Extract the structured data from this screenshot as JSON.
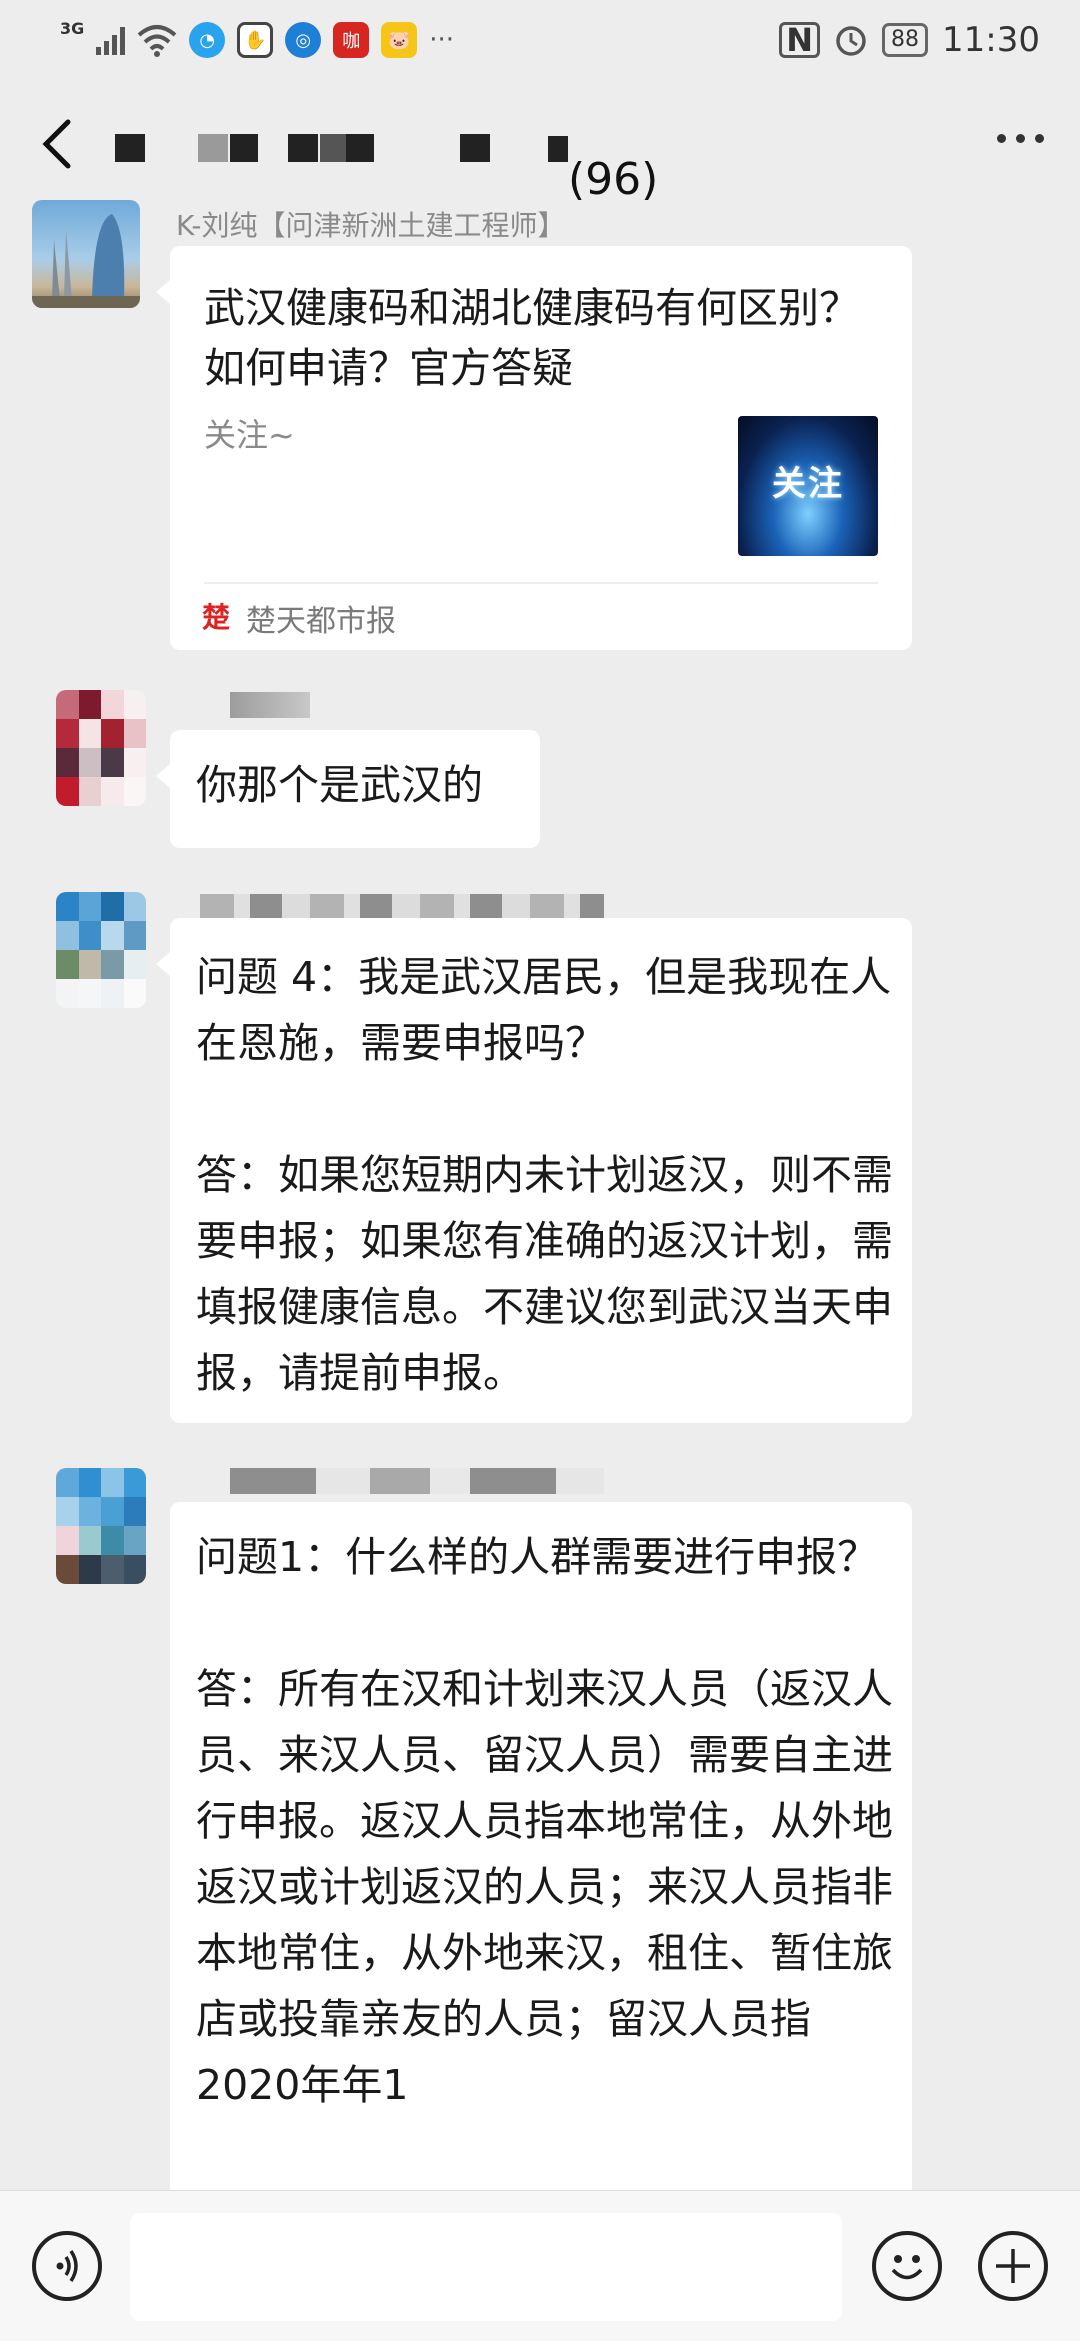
{
  "status_bar": {
    "signal_label": "3G",
    "time": "11:30",
    "battery": "88",
    "overflow": "···",
    "icons": [
      "signal-icon",
      "wifi-icon",
      "app-icon-blue",
      "app-icon-shield",
      "app-icon-globe",
      "app-icon-red",
      "app-icon-yellow",
      "nfc-icon",
      "alarm-icon",
      "battery-icon"
    ]
  },
  "header": {
    "member_count": "(96)"
  },
  "messages": [
    {
      "sender": "K-刘纯【问津新洲土建工程师】",
      "type": "link_card",
      "card": {
        "title": "武汉健康码和湖北健康码有何区别？如何申请？官方答疑",
        "description": "关注~",
        "thumb_text": "关注",
        "source": "楚天都市报"
      }
    },
    {
      "sender": "",
      "type": "text",
      "text": "你那个是武汉的"
    },
    {
      "sender": "",
      "type": "text",
      "text": "问题 4：我是武汉居民，但是我现在人在恩施，需要申报吗？\n\n答：如果您短期内未计划返汉，则不需要申报；如果您有准确的返汉计划，需填报健康信息。不建议您到武汉当天申报，请提前申报。"
    },
    {
      "sender": "",
      "type": "text",
      "text": "问题1：什么样的人群需要进行申报？\n\n答：所有在汉和计划来汉人员（返汉人员、来汉人员、留汉人员）需要自主进行申报。返汉人员指本地常住，从外地返汉或计划返汉的人员；来汉人员指非本地常住，从外地来汉，租住、暂住旅店或投靠亲友的人员；留汉人员指2020年年1"
    }
  ],
  "input_bar": {
    "voice_button": "voice-icon",
    "emoji_button": "emoji-icon",
    "plus_button": "plus-icon"
  }
}
